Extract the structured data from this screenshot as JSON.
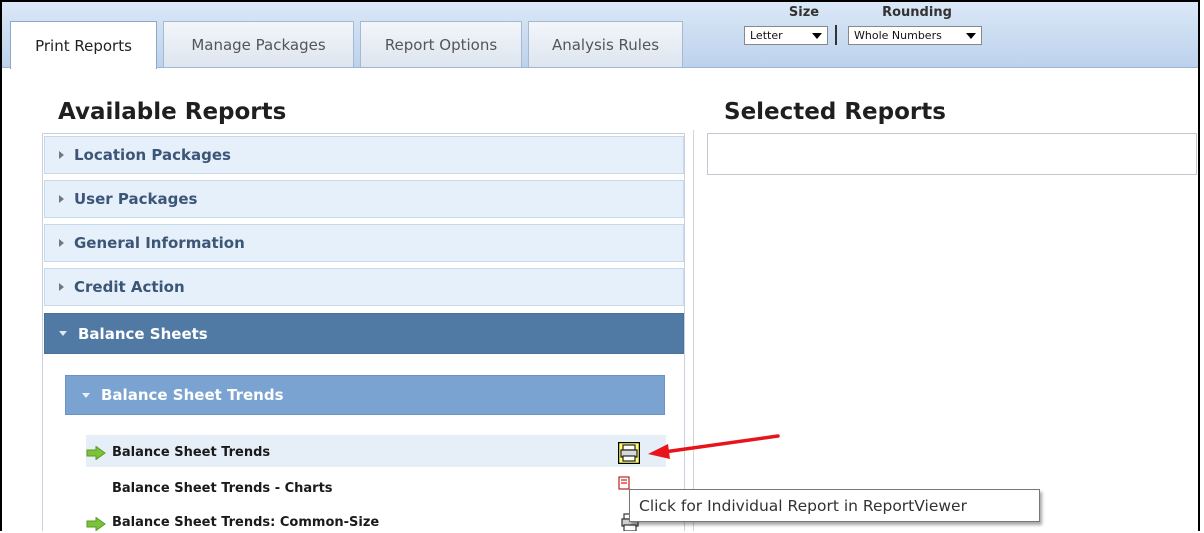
{
  "tabs": [
    {
      "label": "Print Reports",
      "active": true
    },
    {
      "label": "Manage Packages",
      "active": false
    },
    {
      "label": "Report Options",
      "active": false
    },
    {
      "label": "Analysis Rules",
      "active": false
    }
  ],
  "size": {
    "label": "Size",
    "value": "Letter"
  },
  "rounding": {
    "label": "Rounding",
    "value": "Whole Numbers"
  },
  "available": {
    "title": "Available Reports"
  },
  "selected": {
    "title": "Selected Reports"
  },
  "packages": [
    {
      "label": "Location Packages"
    },
    {
      "label": "User Packages"
    },
    {
      "label": "General Information"
    },
    {
      "label": "Credit Action"
    },
    {
      "label": "Balance Sheets"
    }
  ],
  "subgroup": {
    "label": "Balance Sheet Trends"
  },
  "reports": [
    {
      "label": "Balance Sheet Trends",
      "has_arrow": true
    },
    {
      "label": "Balance Sheet Trends - Charts",
      "has_arrow": false
    },
    {
      "label": "Balance Sheet Trends: Common-Size",
      "has_arrow": true
    }
  ],
  "tooltip": {
    "text": "Click for Individual Report in ReportViewer"
  },
  "colors": {
    "accent": "#5079a3",
    "subgroup": "#7aa3d1",
    "highlight": "#ffff66",
    "annotation": "#e8141c"
  }
}
